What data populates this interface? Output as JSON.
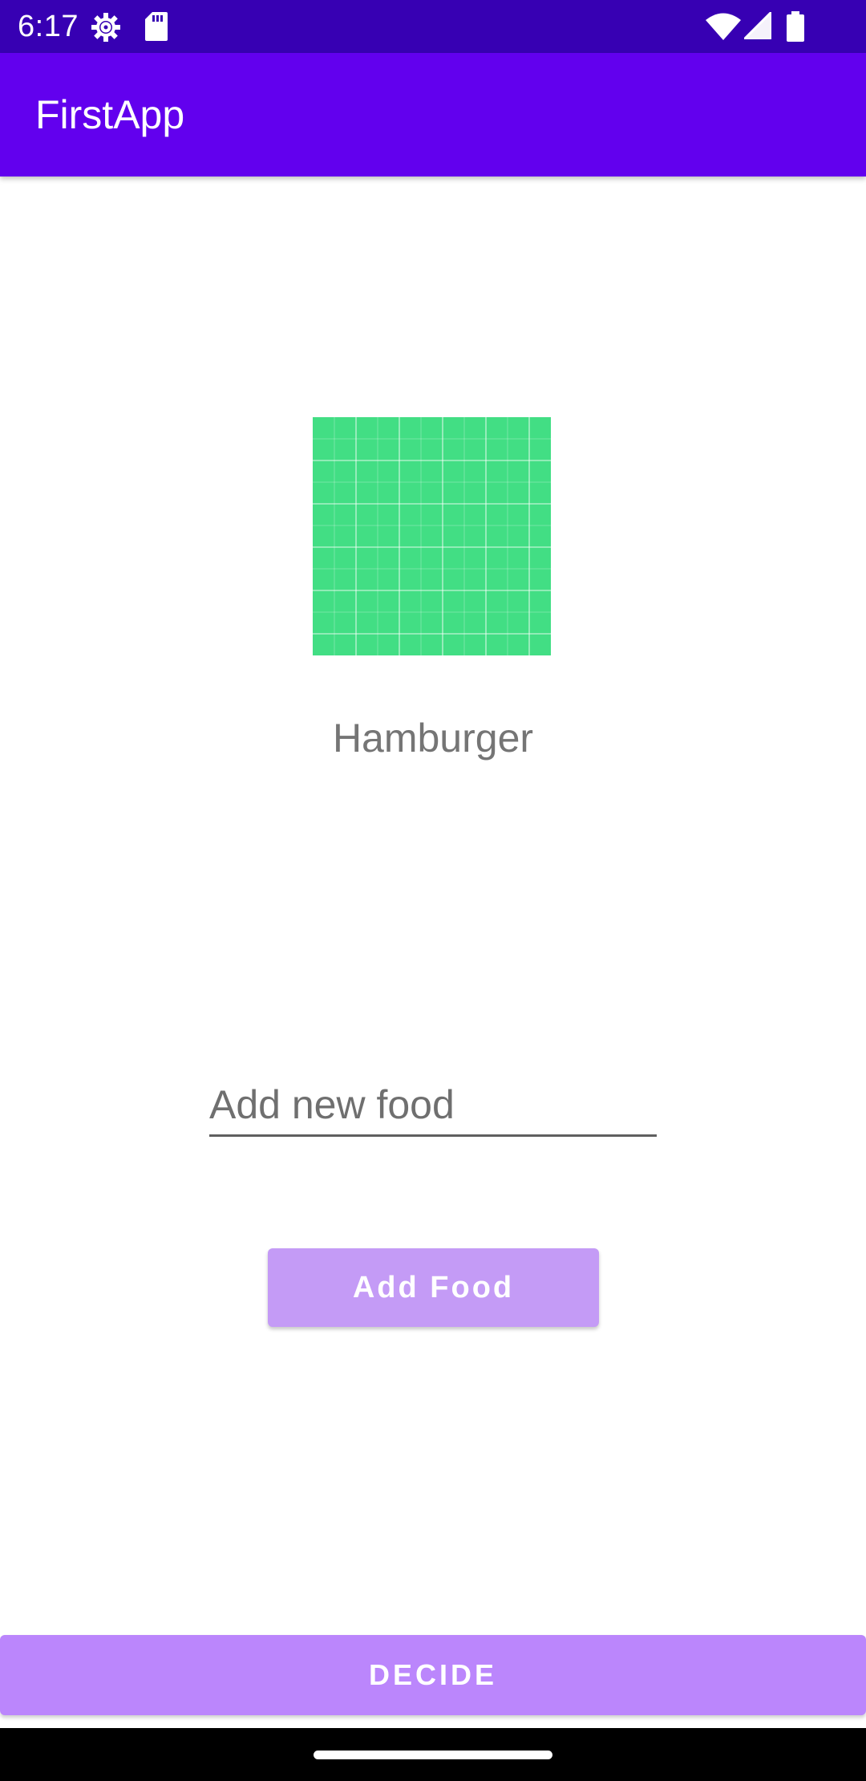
{
  "status_bar": {
    "time": "6:17",
    "icons": [
      "settings-gear-icon",
      "sd-card-icon",
      "wifi-icon",
      "signal-icon",
      "battery-icon"
    ],
    "background": "#3700b3"
  },
  "app_bar": {
    "title": "FirstApp",
    "background": "#6200ee"
  },
  "main": {
    "food_image": {
      "icon": "food-placeholder-image",
      "color": "#42de84"
    },
    "food_name": "Hamburger",
    "new_food_input": {
      "placeholder": "Add new food",
      "value": ""
    },
    "add_food_button": {
      "label": "Add Food",
      "color": "#c49bf6"
    },
    "decide_button": {
      "label": "DECIDE",
      "color": "#bb86fc"
    }
  },
  "nav_bar": {
    "handle": "home-gesture-handle"
  }
}
